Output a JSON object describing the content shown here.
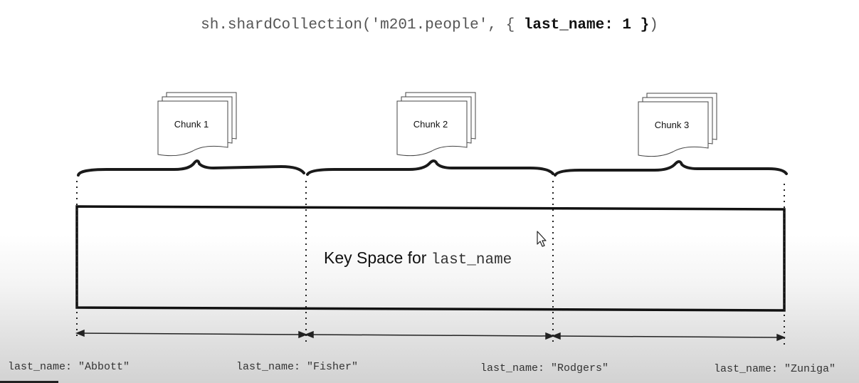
{
  "command": {
    "prefix": "sh.shardCollection('m201.people', { ",
    "key": "last_name: 1 }",
    "suffix": ")"
  },
  "chunks": [
    "Chunk 1",
    "Chunk 2",
    "Chunk 3"
  ],
  "key_space": {
    "label": "Key Space for",
    "field": "last_name"
  },
  "boundaries": [
    "last_name: \"Abbott\"",
    "last_name: \"Fisher\"",
    "last_name: \"Rodgers\"",
    "last_name: \"Zuniga\""
  ]
}
